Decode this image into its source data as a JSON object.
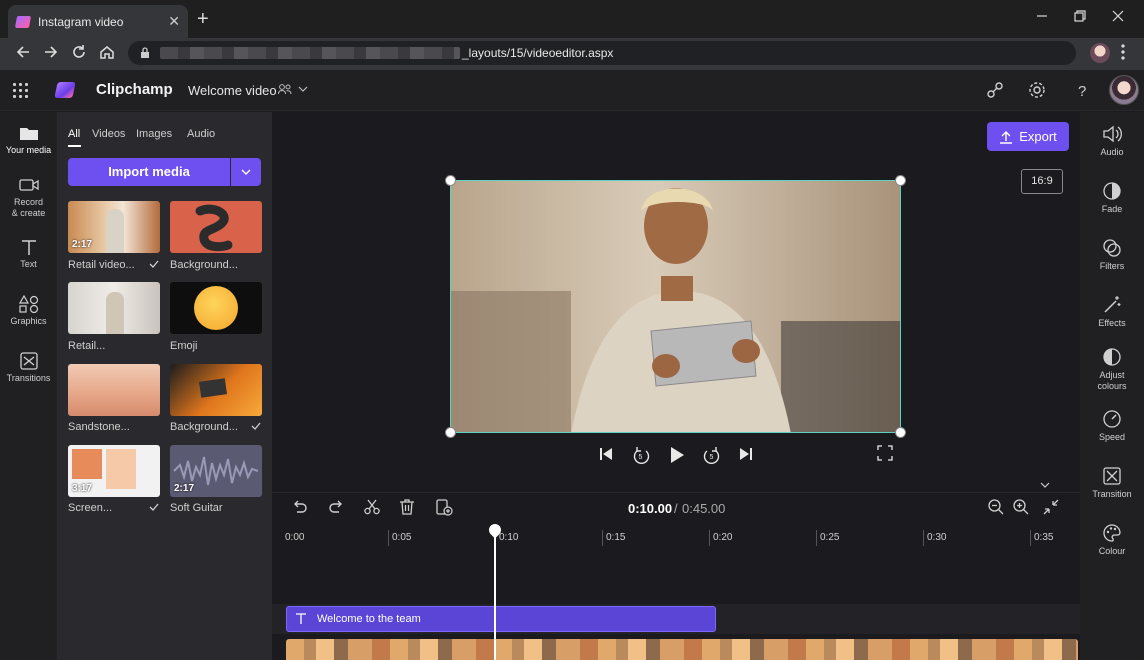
{
  "browser": {
    "tab_title": "Instagram video",
    "tab_close": "✕",
    "new_tab": "+",
    "url_visible": "_layouts/15/videoeditor.aspx"
  },
  "app": {
    "name": "Clipchamp",
    "project_name": "Welcome video",
    "accent": "#6e4ff0"
  },
  "left_rail": {
    "items": [
      {
        "label": "Your media",
        "icon": "folder-icon"
      },
      {
        "label": "Record\n& create",
        "icon": "camera-icon"
      },
      {
        "label": "Text",
        "icon": "text-icon"
      },
      {
        "label": "Graphics",
        "icon": "shapes-icon"
      },
      {
        "label": "Transitions",
        "icon": "transitions-icon"
      }
    ]
  },
  "media_panel": {
    "tabs": [
      "All",
      "Videos",
      "Images",
      "Audio"
    ],
    "import_label": "Import media",
    "thumbnails": [
      {
        "label": "Retail video...",
        "duration": "2:17",
        "checked": true
      },
      {
        "label": "Background...",
        "duration": "",
        "checked": false
      },
      {
        "label": "Retail...",
        "duration": "",
        "checked": false
      },
      {
        "label": "Emoji",
        "duration": "",
        "checked": false
      },
      {
        "label": "Sandstone...",
        "duration": "",
        "checked": false
      },
      {
        "label": "Background...",
        "duration": "",
        "checked": true
      },
      {
        "label": "Screen...",
        "duration": "3:17",
        "checked": true
      },
      {
        "label": "Soft Guitar",
        "duration": "2:17",
        "checked": false
      }
    ]
  },
  "stage": {
    "export_label": "Export",
    "aspect_ratio": "16:9"
  },
  "right_rail": {
    "items": [
      {
        "label": "Audio",
        "icon": "speaker-icon"
      },
      {
        "label": "Fade",
        "icon": "fade-icon"
      },
      {
        "label": "Filters",
        "icon": "filters-icon"
      },
      {
        "label": "Effects",
        "icon": "magic-wand-icon"
      },
      {
        "label": "Adjust\ncolours",
        "icon": "contrast-icon"
      },
      {
        "label": "Speed",
        "icon": "speedometer-icon"
      },
      {
        "label": "Transition",
        "icon": "transition-icon"
      },
      {
        "label": "Colour",
        "icon": "palette-icon"
      }
    ]
  },
  "timeline": {
    "current_time": "0:10.00",
    "separator": "/",
    "total_time": "0:45.00",
    "ticks": [
      "0:00",
      "0:05",
      "0:10",
      "0:15",
      "0:20",
      "0:25",
      "0:30",
      "0:35"
    ],
    "text_clip_label": "Welcome to the team"
  }
}
